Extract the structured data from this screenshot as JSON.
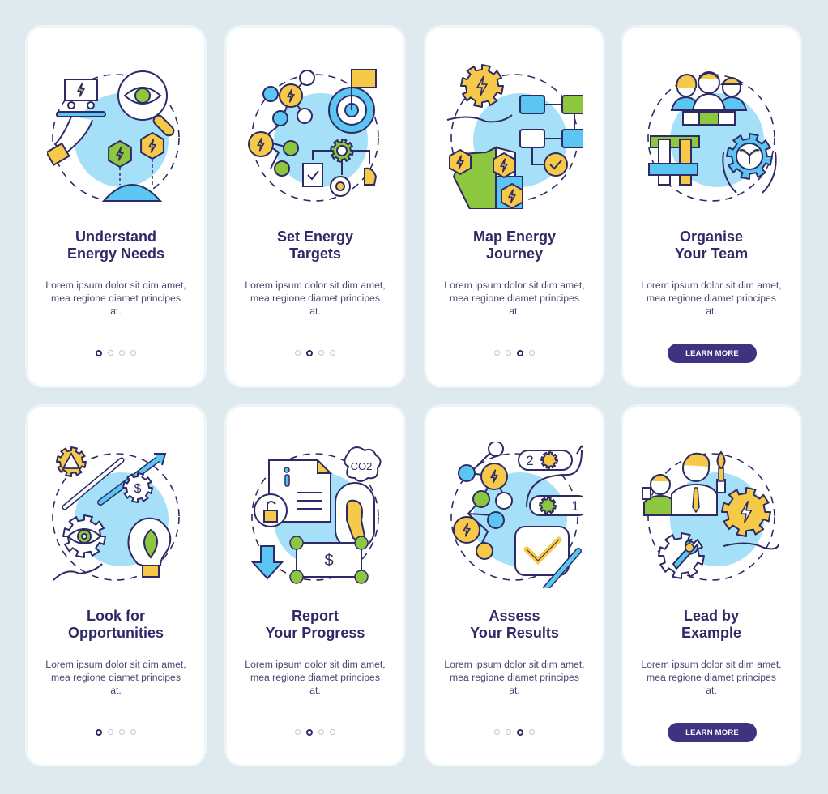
{
  "colors": {
    "background": "#dfeaef",
    "card": "#ffffff",
    "title": "#2e2a66",
    "text": "#4a4770",
    "button": "#3e3281",
    "dot_inactive": "#c4c4cc",
    "dot_active": "#2e2a66",
    "accent_blue": "#5cc6f2",
    "accent_yellow": "#f7c948",
    "accent_green": "#8dc63f"
  },
  "cards": [
    {
      "title_line1": "Understand",
      "title_line2": "Energy Needs",
      "body": "Lorem ipsum dolor sit dim amet, mea regione diamet principes at.",
      "active_dot": 1,
      "footer": "dots",
      "illustration": "shopping-cart-eye-globe-energy-icon"
    },
    {
      "title_line1": "Set Energy",
      "title_line2": "Targets",
      "body": "Lorem ipsum dolor sit dim amet, mea regione diamet principes at.",
      "active_dot": 2,
      "footer": "dots",
      "illustration": "target-flag-network-gear-icon"
    },
    {
      "title_line1": "Map Energy",
      "title_line2": "Journey",
      "body": "Lorem ipsum dolor sit dim amet, mea regione diamet principes at.",
      "active_dot": 3,
      "footer": "dots",
      "illustration": "gear-map-flowchart-icon"
    },
    {
      "title_line1": "Organise",
      "title_line2": "Your Team",
      "body": "Lorem ipsum dolor sit dim amet, mea regione diamet principes at.",
      "footer": "button",
      "button_label": "LEARN MORE",
      "illustration": "team-puzzle-hands-gear-icon"
    },
    {
      "title_line1": "Look for",
      "title_line2": "Opportunities",
      "body": "Lorem ipsum dolor sit dim amet, mea regione diamet principes at.",
      "active_dot": 1,
      "footer": "dots",
      "illustration": "eye-gear-bulb-arrows-icon"
    },
    {
      "title_line1": "Report",
      "title_line2": "Your Progress",
      "body": "Lorem ipsum dolor sit dim amet, mea regione diamet principes at.",
      "active_dot": 2,
      "footer": "dots",
      "illustration": "document-co2-footprint-money-icon",
      "co2_label": "CO2",
      "dollar_label": "$"
    },
    {
      "title_line1": "Assess",
      "title_line2": "Your Results",
      "body": "Lorem ipsum dolor sit dim amet, mea regione diamet principes at.",
      "active_dot": 3,
      "footer": "dots",
      "illustration": "network-steps-checkbox-pen-icon",
      "step_labels": [
        "2",
        "1"
      ]
    },
    {
      "title_line1": "Lead by",
      "title_line2": "Example",
      "body": "Lorem ipsum dolor sit dim amet, mea regione diamet principes at.",
      "footer": "button",
      "button_label": "LEARN MORE",
      "illustration": "leader-torch-gear-wrench-icon"
    }
  ],
  "dot_count": 4
}
